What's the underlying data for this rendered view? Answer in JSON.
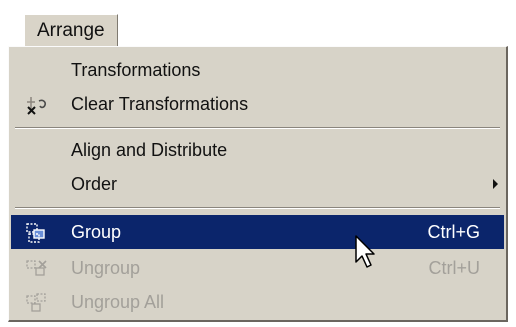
{
  "menubar": {
    "arrange_label": "Arrange"
  },
  "menu": {
    "items": [
      {
        "label": "Transformations",
        "shortcut": "",
        "icon": "",
        "state": "normal"
      },
      {
        "label": "Clear Transformations",
        "shortcut": "",
        "icon": "clear-transformations-icon",
        "state": "normal"
      },
      {
        "label": "Align and Distribute",
        "shortcut": "",
        "icon": "",
        "state": "normal"
      },
      {
        "label": "Order",
        "shortcut": "",
        "icon": "submenu-arrow-icon",
        "state": "normal"
      },
      {
        "label": "Group",
        "shortcut": "Ctrl+G",
        "icon": "group-icon",
        "state": "selected"
      },
      {
        "label": "Ungroup",
        "shortcut": "Ctrl+U",
        "icon": "ungroup-icon",
        "state": "disabled"
      },
      {
        "label": "Ungroup All",
        "shortcut": "",
        "icon": "ungroup-all-icon",
        "state": "disabled"
      }
    ]
  },
  "colors": {
    "menu_bg": "#d7d3c8",
    "selection_bg": "#0b256b",
    "selection_text": "#ffffff",
    "disabled_text": "#a3a09a"
  }
}
